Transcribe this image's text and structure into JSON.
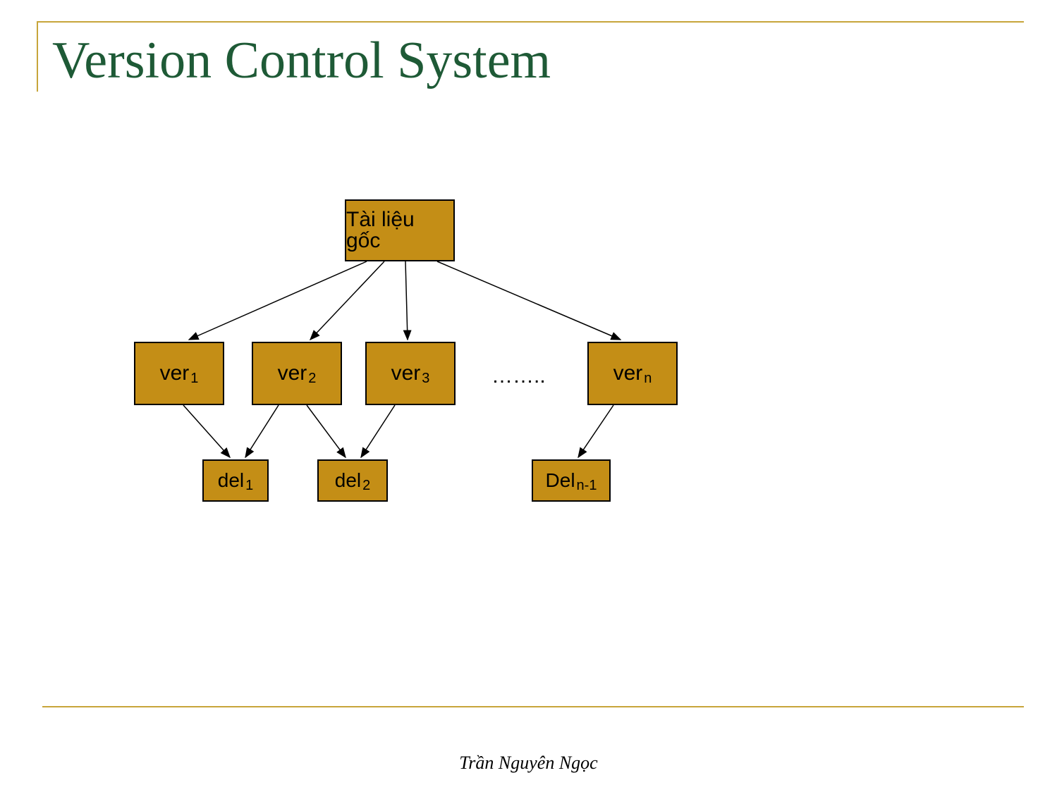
{
  "slide": {
    "title": "Version Control System",
    "footer": "Trần Nguyên Ngọc"
  },
  "diagram": {
    "root": {
      "label": "Tài liệu gốc"
    },
    "versions": [
      {
        "base": "ver",
        "sub": "1"
      },
      {
        "base": "ver",
        "sub": "2"
      },
      {
        "base": "ver",
        "sub": "3"
      },
      {
        "base": "ver",
        "sub": "n"
      }
    ],
    "ellipsis": "……..",
    "deltas": [
      {
        "base": "del",
        "sub": "1"
      },
      {
        "base": "del",
        "sub": "2"
      },
      {
        "base": "Del",
        "sub": "n-1"
      }
    ]
  }
}
